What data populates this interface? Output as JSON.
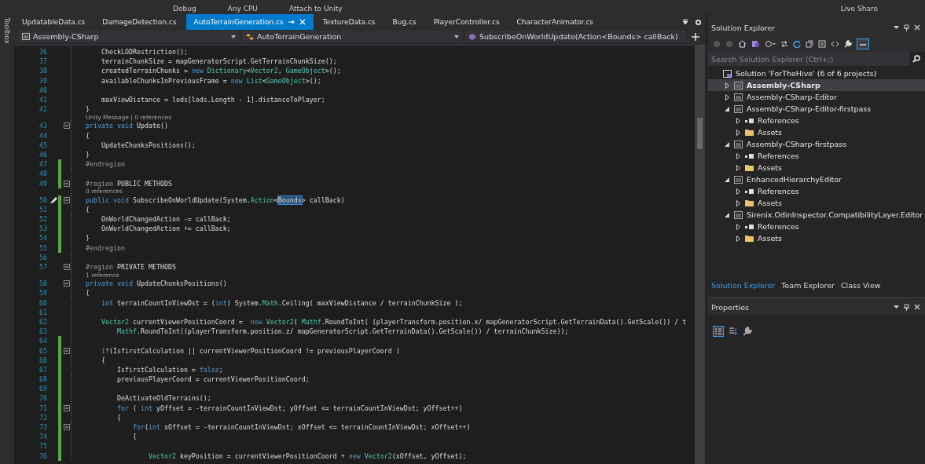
{
  "toolbar": {
    "items": [
      "Debug",
      "Any CPU",
      "Attach to Unity"
    ],
    "live_share": "Live Share"
  },
  "side_strip": {
    "label": "Toolbox"
  },
  "tabs": [
    {
      "label": "UpdatableData.cs",
      "selected": false
    },
    {
      "label": "DamageDetection.cs",
      "selected": false
    },
    {
      "label": "AutoTerrainGeneration.cs",
      "selected": true
    },
    {
      "label": "TextureData.cs",
      "selected": false
    },
    {
      "label": "Bug.cs",
      "selected": false
    },
    {
      "label": "PlayerController.cs",
      "selected": false
    },
    {
      "label": "CharacterAnimator.cs",
      "selected": false
    }
  ],
  "nav_bar": {
    "project": "Assembly-CSharp",
    "class": "AutoTerrainGeneration",
    "member": "SubscribeOnWorldUpdate(Action<Bounds> callBack)"
  },
  "editor": {
    "lines": [
      {
        "kind": "code",
        "number": "36",
        "changed": false,
        "fold": false,
        "segments": [
          {
            "kind": "plain",
            "text": "    CheckLODRestriction();"
          }
        ]
      },
      {
        "kind": "code",
        "number": "37",
        "changed": false,
        "fold": false,
        "segments": [
          {
            "kind": "plain",
            "text": "    terrainChunkSize = mapGeneratorScript.GetTerrainChunkSize();"
          }
        ]
      },
      {
        "kind": "code",
        "number": "38",
        "changed": false,
        "fold": false,
        "segments": [
          {
            "kind": "plain",
            "text": "    createdTerrainChunks = "
          },
          {
            "kind": "keyword",
            "text": "new"
          },
          {
            "kind": "type",
            "text": " Dictionary"
          },
          {
            "kind": "plain",
            "text": "<"
          },
          {
            "kind": "type",
            "text": "Vector2"
          },
          {
            "kind": "plain",
            "text": ", "
          },
          {
            "kind": "type",
            "text": "GameObject"
          },
          {
            "kind": "plain",
            "text": ">();"
          }
        ]
      },
      {
        "kind": "code",
        "number": "39",
        "changed": false,
        "fold": false,
        "segments": [
          {
            "kind": "plain",
            "text": "    availableChunksInPreviousFrame = "
          },
          {
            "kind": "keyword",
            "text": "new"
          },
          {
            "kind": "type",
            "text": " List"
          },
          {
            "kind": "plain",
            "text": "<"
          },
          {
            "kind": "type",
            "text": "GameObject"
          },
          {
            "kind": "plain",
            "text": ">();"
          }
        ]
      },
      {
        "kind": "code",
        "number": "40",
        "changed": false,
        "fold": false
      },
      {
        "kind": "code",
        "number": "41",
        "changed": false,
        "fold": false,
        "segments": [
          {
            "kind": "plain",
            "text": "    maxViewDistance = lods[lods.Length - 1].distanceToPlayer;"
          }
        ]
      },
      {
        "kind": "code",
        "number": "42",
        "changed": false,
        "fold": false,
        "segments": [
          {
            "kind": "plain",
            "text": "}"
          }
        ]
      },
      {
        "kind": "lens",
        "text": "Unity Message | 0 references"
      },
      {
        "kind": "code",
        "number": "43",
        "changed": false,
        "fold": true,
        "segments": [
          {
            "kind": "keyword",
            "text": "private void"
          },
          {
            "kind": "plain",
            "text": " Update()"
          }
        ]
      },
      {
        "kind": "code",
        "number": "44",
        "changed": false,
        "fold": false,
        "segments": [
          {
            "kind": "plain",
            "text": "{"
          }
        ]
      },
      {
        "kind": "code",
        "number": "45",
        "changed": false,
        "fold": false,
        "segments": [
          {
            "kind": "plain",
            "text": "    UpdateChunksPositions();"
          }
        ]
      },
      {
        "kind": "code",
        "number": "46",
        "changed": false,
        "fold": false,
        "segments": [
          {
            "kind": "plain",
            "text": "}"
          }
        ]
      },
      {
        "kind": "code",
        "number": "47",
        "changed": true,
        "fold": false,
        "segments": [
          {
            "kind": "preproc",
            "text": "#endregion"
          }
        ]
      },
      {
        "kind": "code",
        "number": "48",
        "changed": true,
        "fold": false
      },
      {
        "kind": "code",
        "number": "49",
        "changed": true,
        "fold": true,
        "segments": [
          {
            "kind": "preproc",
            "text": "#region"
          },
          {
            "kind": "plain",
            "text": " PUBLIC METHODS"
          }
        ]
      },
      {
        "kind": "lens",
        "text": "0 references"
      },
      {
        "kind": "code",
        "number": "50",
        "changed": true,
        "fold": true,
        "edited": true,
        "segments": [
          {
            "kind": "keyword",
            "text": "public void"
          },
          {
            "kind": "plain",
            "text": " SubscribeOnWorldUpdate(System."
          },
          {
            "kind": "type",
            "text": "Action"
          },
          {
            "kind": "plain",
            "text": "<"
          },
          {
            "kind": "selection",
            "text": "Bounds"
          },
          {
            "kind": "plain",
            "text": "> callBack)"
          }
        ]
      },
      {
        "kind": "code",
        "number": "51",
        "changed": true,
        "fold": false,
        "segments": [
          {
            "kind": "plain",
            "text": "{"
          }
        ]
      },
      {
        "kind": "code",
        "number": "52",
        "changed": true,
        "fold": false,
        "segments": [
          {
            "kind": "plain",
            "text": "    OnWorldChangedAction -= callBack;"
          }
        ]
      },
      {
        "kind": "code",
        "number": "53",
        "changed": true,
        "fold": false,
        "segments": [
          {
            "kind": "plain",
            "text": "    OnWorldChangedAction += callBack;"
          }
        ]
      },
      {
        "kind": "code",
        "number": "54",
        "changed": true,
        "fold": false,
        "segments": [
          {
            "kind": "plain",
            "text": "}"
          }
        ]
      },
      {
        "kind": "code",
        "number": "55",
        "changed": true,
        "fold": false,
        "segments": [
          {
            "kind": "preproc",
            "text": "#endregion"
          }
        ]
      },
      {
        "kind": "code",
        "number": "56",
        "changed": false,
        "fold": false
      },
      {
        "kind": "code",
        "number": "57",
        "changed": false,
        "fold": true,
        "segments": [
          {
            "kind": "preproc",
            "text": "#region"
          },
          {
            "kind": "plain",
            "text": " PRIVATE METHODS"
          }
        ]
      },
      {
        "kind": "lens",
        "text": "1 reference"
      },
      {
        "kind": "code",
        "number": "58",
        "changed": false,
        "fold": true,
        "segments": [
          {
            "kind": "keyword",
            "text": "private void"
          },
          {
            "kind": "plain",
            "text": " UpdateChunksPositions()"
          }
        ]
      },
      {
        "kind": "code",
        "number": "59",
        "changed": false,
        "fold": false,
        "segments": [
          {
            "kind": "plain",
            "text": "{"
          }
        ]
      },
      {
        "kind": "code",
        "number": "60",
        "changed": false,
        "fold": false,
        "segments": [
          {
            "kind": "keyword",
            "text": "    int"
          },
          {
            "kind": "plain",
            "text": " terrainCountInViewDst = ("
          },
          {
            "kind": "keyword",
            "text": "int"
          },
          {
            "kind": "plain",
            "text": ") System."
          },
          {
            "kind": "type",
            "text": "Math"
          },
          {
            "kind": "plain",
            "text": ".Ceiling( maxViewDistance / terrainChunkSize );"
          }
        ]
      },
      {
        "kind": "code",
        "number": "61",
        "changed": false,
        "fold": false
      },
      {
        "kind": "code",
        "number": "62",
        "changed": false,
        "fold": false,
        "segments": [
          {
            "kind": "type",
            "text": "    Vector2"
          },
          {
            "kind": "plain",
            "text": " currentViewerPositionCoord =  "
          },
          {
            "kind": "keyword",
            "text": "new"
          },
          {
            "kind": "type",
            "text": " Vector2"
          },
          {
            "kind": "plain",
            "text": "( "
          },
          {
            "kind": "type",
            "text": "Mathf"
          },
          {
            "kind": "plain",
            "text": ".RoundToInt( (playerTransform.position.x/ mapGeneratorScript.GetTerrainData().GetScale()) / t"
          }
        ]
      },
      {
        "kind": "code",
        "number": "63",
        "changed": false,
        "fold": false,
        "segments": [
          {
            "kind": "type",
            "text": "        Mathf"
          },
          {
            "kind": "plain",
            "text": ".RoundToInt((playerTransform.position.z/ mapGeneratorScript.GetTerrainData().GetScale()) / terrainChunkSize));"
          }
        ]
      },
      {
        "kind": "code",
        "number": "64",
        "changed": true,
        "fold": false
      },
      {
        "kind": "code",
        "number": "65",
        "changed": true,
        "fold": true,
        "segments": [
          {
            "kind": "keyword",
            "text": "    if"
          },
          {
            "kind": "plain",
            "text": "(IsfirstCalculation || currentViewerPositionCoord != previousPlayerCoord )"
          }
        ]
      },
      {
        "kind": "code",
        "number": "66",
        "changed": true,
        "fold": false,
        "segments": [
          {
            "kind": "plain",
            "text": "    {"
          }
        ]
      },
      {
        "kind": "code",
        "number": "67",
        "changed": true,
        "fold": false,
        "segments": [
          {
            "kind": "plain",
            "text": "        IsfirstCalculation = "
          },
          {
            "kind": "keyword",
            "text": "false"
          },
          {
            "kind": "plain",
            "text": ";"
          }
        ]
      },
      {
        "kind": "code",
        "number": "68",
        "changed": true,
        "fold": false,
        "segments": [
          {
            "kind": "plain",
            "text": "        previousPlayerCoord = currentViewerPositionCoord;"
          }
        ]
      },
      {
        "kind": "code",
        "number": "69",
        "changed": true,
        "fold": false
      },
      {
        "kind": "code",
        "number": "70",
        "changed": true,
        "fold": false,
        "segments": [
          {
            "kind": "plain",
            "text": "        DeActivateOldTerrains();"
          }
        ]
      },
      {
        "kind": "code",
        "number": "71",
        "changed": true,
        "fold": true,
        "segments": [
          {
            "kind": "keyword",
            "text": "        for"
          },
          {
            "kind": "plain",
            "text": " ( "
          },
          {
            "kind": "keyword",
            "text": "int"
          },
          {
            "kind": "plain",
            "text": " yOffset = -terrainCountInViewDst; yOffset <= terrainCountInViewDst; yOffset++)"
          }
        ]
      },
      {
        "kind": "code",
        "number": "72",
        "changed": true,
        "fold": false,
        "segments": [
          {
            "kind": "plain",
            "text": "        {"
          }
        ]
      },
      {
        "kind": "code",
        "number": "73",
        "changed": true,
        "fold": true,
        "segments": [
          {
            "kind": "keyword",
            "text": "            for"
          },
          {
            "kind": "plain",
            "text": "("
          },
          {
            "kind": "keyword",
            "text": "int"
          },
          {
            "kind": "plain",
            "text": " xOffset = -terrainCountInViewDst; xOffset <= terrainCountInViewDst; xOffset++)"
          }
        ]
      },
      {
        "kind": "code",
        "number": "74",
        "changed": true,
        "fold": false,
        "segments": [
          {
            "kind": "plain",
            "text": "            {"
          }
        ]
      },
      {
        "kind": "code",
        "number": "75",
        "changed": true,
        "fold": false
      },
      {
        "kind": "code",
        "number": "76",
        "changed": true,
        "fold": false,
        "segments": [
          {
            "kind": "type",
            "text": "                Vector2"
          },
          {
            "kind": "plain",
            "text": " keyPosition = currentViewerPositionCoord + "
          },
          {
            "kind": "keyword",
            "text": "new"
          },
          {
            "kind": "type",
            "text": " Vector2"
          },
          {
            "kind": "plain",
            "text": "(xOffset, yOffset);"
          }
        ]
      }
    ]
  },
  "solution_explorer": {
    "title": "Solution Explorer",
    "search": {
      "placeholder": "Search Solution Explorer (Ctrl+;)"
    },
    "tree": [
      {
        "kind": "solution",
        "label": "Solution 'ForTheHive' (6 of 6 projects)",
        "selected": false,
        "children": [
          {
            "kind": "project",
            "label": "Assembly-CSharp",
            "selected": true,
            "startup": true,
            "expanded": false
          },
          {
            "kind": "project",
            "label": "Assembly-CSharp-Editor",
            "selected": false,
            "startup": false,
            "expanded": false
          },
          {
            "kind": "project",
            "label": "Assembly-CSharp-Editor-firstpass",
            "selected": false,
            "startup": false,
            "expanded": true,
            "children": [
              {
                "kind": "references",
                "label": "References",
                "selected": false,
                "expanded": false
              },
              {
                "kind": "folder",
                "label": "Assets",
                "selected": false,
                "expanded": false
              }
            ]
          },
          {
            "kind": "project",
            "label": "Assembly-CSharp-firstpass",
            "selected": false,
            "startup": false,
            "expanded": true,
            "children": [
              {
                "kind": "references",
                "label": "References",
                "selected": false,
                "expanded": false
              },
              {
                "kind": "folder",
                "label": "Assets",
                "selected": false,
                "expanded": false
              }
            ]
          },
          {
            "kind": "project",
            "label": "EnhancedHierarchyEditor",
            "selected": false,
            "startup": false,
            "expanded": true,
            "children": [
              {
                "kind": "references",
                "label": "References",
                "selected": false,
                "expanded": false
              },
              {
                "kind": "folder",
                "label": "Assets",
                "selected": false,
                "expanded": false
              }
            ]
          },
          {
            "kind": "project",
            "label": "Sirenix.OdinInspector.CompatibilityLayer.Editor",
            "selected": false,
            "startup": false,
            "expanded": true,
            "children": [
              {
                "kind": "references",
                "label": "References",
                "selected": false,
                "expanded": false
              },
              {
                "kind": "folder",
                "label": "Assets",
                "selected": false,
                "expanded": false
              }
            ]
          }
        ]
      }
    ]
  },
  "panel_tabs": [
    {
      "label": "Solution Explorer",
      "selected": true
    },
    {
      "label": "Team Explorer",
      "selected": false
    },
    {
      "label": "Class View",
      "selected": false
    }
  ],
  "properties": {
    "title": "Properties"
  }
}
